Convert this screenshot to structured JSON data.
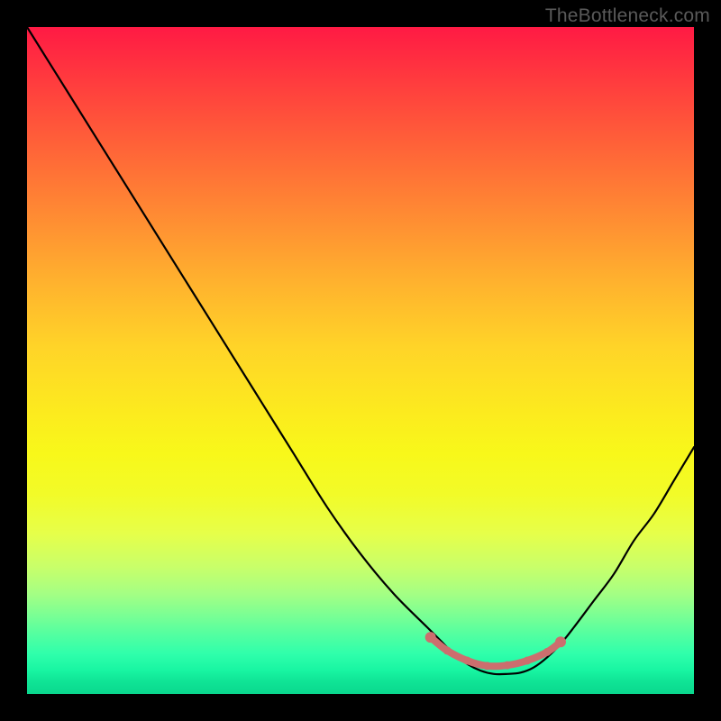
{
  "watermark": "TheBottleneck.com",
  "chart_data": {
    "type": "line",
    "title": "",
    "xlabel": "",
    "ylabel": "",
    "xlim": [
      0,
      100
    ],
    "ylim": [
      0,
      100
    ],
    "series": [
      {
        "name": "bottleneck-curve",
        "x": [
          0,
          5,
          10,
          15,
          20,
          25,
          30,
          35,
          40,
          45,
          50,
          55,
          60,
          62,
          64,
          66,
          68,
          70,
          72,
          74,
          76,
          78,
          80,
          82,
          85,
          88,
          91,
          94,
          97,
          100
        ],
        "values": [
          100,
          92,
          84,
          76,
          68,
          60,
          52,
          44,
          36,
          28,
          21,
          15,
          10,
          8,
          6,
          4.5,
          3.5,
          3,
          3,
          3.2,
          4,
          5.5,
          7.5,
          10,
          14,
          18,
          23,
          27,
          32,
          37
        ]
      }
    ],
    "markers": {
      "name": "highlight-band",
      "color": "#cc6e6e",
      "points": [
        {
          "x": 60.5,
          "y": 8.5
        },
        {
          "x": 63,
          "y": 6.5
        },
        {
          "x": 66,
          "y": 5
        },
        {
          "x": 69,
          "y": 4.2
        },
        {
          "x": 72,
          "y": 4.3
        },
        {
          "x": 75,
          "y": 5
        },
        {
          "x": 78,
          "y": 6.3
        },
        {
          "x": 80,
          "y": 7.8
        }
      ]
    },
    "gradient_stops": [
      {
        "pct": 0,
        "color": "#ff1a44"
      },
      {
        "pct": 50,
        "color": "#ffe028"
      },
      {
        "pct": 70,
        "color": "#f8f81a"
      },
      {
        "pct": 100,
        "color": "#0ad88e"
      }
    ]
  }
}
